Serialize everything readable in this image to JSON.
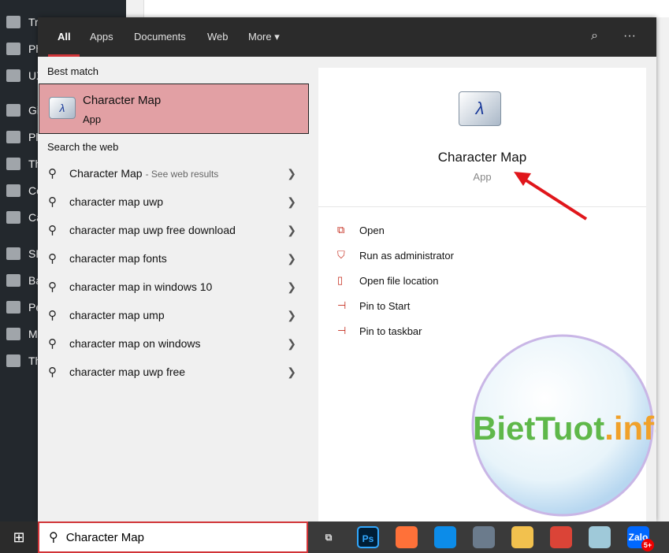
{
  "wp_sidebar": {
    "items": [
      "Tr",
      "Ph",
      "UX",
      "Gi",
      "Pl",
      "Th",
      "Co",
      "Ca",
      "SE",
      "Ba",
      "Pe",
      "M",
      "Th"
    ]
  },
  "search_panel": {
    "tabs": [
      {
        "label": "All",
        "active": true
      },
      {
        "label": "Apps"
      },
      {
        "label": "Documents"
      },
      {
        "label": "Web"
      },
      {
        "label": "More ▾"
      }
    ],
    "header_icons": [
      "feedback-icon",
      "more-options-icon"
    ],
    "best_match_label": "Best match",
    "best_match": {
      "title": "Character Map",
      "subtitle": "App"
    },
    "web_label": "Search the web",
    "web_results": [
      {
        "prefix": "Character Map",
        "suffix": "- See web results"
      },
      {
        "prefix": "character map",
        "bold": " uwp"
      },
      {
        "prefix": "character map",
        "bold": " uwp free download"
      },
      {
        "prefix": "character map",
        "bold": " fonts"
      },
      {
        "prefix": "character map",
        "bold": " in windows 10"
      },
      {
        "prefix": "character map",
        "bold": " ump"
      },
      {
        "prefix": "character map",
        "bold": " on windows"
      },
      {
        "prefix": "character map",
        "bold": " uwp free"
      }
    ],
    "detail": {
      "title": "Character Map",
      "subtitle": "App",
      "actions": [
        {
          "label": "Open",
          "icon": "open-icon"
        },
        {
          "label": "Run as administrator",
          "icon": "shield-icon"
        },
        {
          "label": "Open file location",
          "icon": "folder-icon"
        },
        {
          "label": "Pin to Start",
          "icon": "pin-icon"
        },
        {
          "label": "Pin to taskbar",
          "icon": "pin-icon"
        }
      ]
    }
  },
  "search_box": {
    "value": "Character Map"
  },
  "taskbar": {
    "apps": [
      {
        "name": "Ps",
        "color": "#001e36"
      },
      {
        "name": "",
        "color": "#ff7139"
      },
      {
        "name": "",
        "color": "#0c8ce9"
      },
      {
        "name": "",
        "color": "#6b7b8c"
      },
      {
        "name": "",
        "color": "#f2c14e"
      },
      {
        "name": "",
        "color": "#db4437"
      },
      {
        "name": "",
        "color": "#9fc9d9"
      },
      {
        "name": "Zalo",
        "color": "#0068ff",
        "badge": "5+"
      }
    ]
  },
  "watermark": {
    "text": "BietTuot.info"
  },
  "colors": {
    "accent": "#d13438",
    "selection": "#e2a0a4"
  }
}
